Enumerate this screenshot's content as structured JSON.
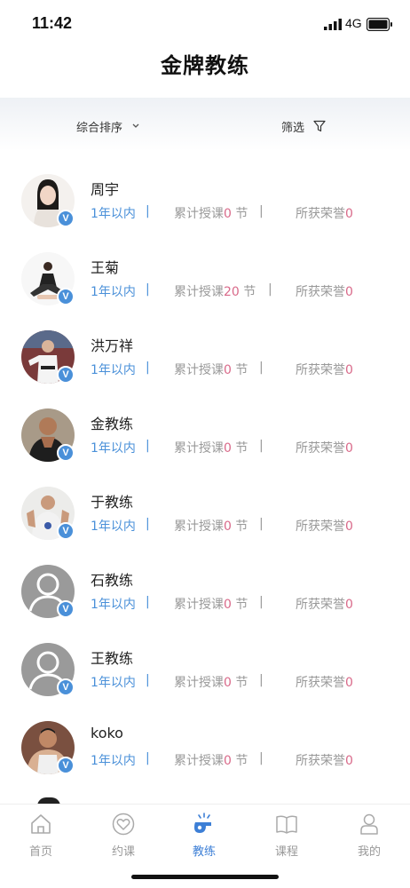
{
  "status_bar": {
    "time": "11:42",
    "network": "4G"
  },
  "header": {
    "title": "金牌教练"
  },
  "filters": {
    "sort_label": "综合排序",
    "filter_label": "筛选"
  },
  "coaches": [
    {
      "name": "周宇",
      "experience": "1年以内",
      "courses_prefix": "累计授课",
      "courses_count": "0",
      "courses_unit": "节",
      "honors_prefix": "所获荣誉",
      "honors_count": "0"
    },
    {
      "name": "王菊",
      "experience": "1年以内",
      "courses_prefix": "累计授课",
      "courses_count": "20",
      "courses_unit": "节",
      "honors_prefix": "所获荣誉",
      "honors_count": "0"
    },
    {
      "name": "洪万祥",
      "experience": "1年以内",
      "courses_prefix": "累计授课",
      "courses_count": "0",
      "courses_unit": "节",
      "honors_prefix": "所获荣誉",
      "honors_count": "0"
    },
    {
      "name": "金教练",
      "experience": "1年以内",
      "courses_prefix": "累计授课",
      "courses_count": "0",
      "courses_unit": "节",
      "honors_prefix": "所获荣誉",
      "honors_count": "0"
    },
    {
      "name": "于教练",
      "experience": "1年以内",
      "courses_prefix": "累计授课",
      "courses_count": "0",
      "courses_unit": "节",
      "honors_prefix": "所获荣誉",
      "honors_count": "0"
    },
    {
      "name": "石教练",
      "experience": "1年以内",
      "courses_prefix": "累计授课",
      "courses_count": "0",
      "courses_unit": "节",
      "honors_prefix": "所获荣誉",
      "honors_count": "0"
    },
    {
      "name": "王教练",
      "experience": "1年以内",
      "courses_prefix": "累计授课",
      "courses_count": "0",
      "courses_unit": "节",
      "honors_prefix": "所获荣誉",
      "honors_count": "0"
    },
    {
      "name": "koko",
      "experience": "1年以内",
      "courses_prefix": "累计授课",
      "courses_count": "0",
      "courses_unit": "节",
      "honors_prefix": "所获荣誉",
      "honors_count": "0"
    }
  ],
  "verified_badge": "V",
  "separator": "|",
  "tabs": [
    {
      "label": "首页",
      "icon": "home-icon"
    },
    {
      "label": "约课",
      "icon": "heart-icon"
    },
    {
      "label": "教练",
      "icon": "whistle-icon"
    },
    {
      "label": "课程",
      "icon": "book-icon"
    },
    {
      "label": "我的",
      "icon": "user-icon"
    }
  ],
  "active_tab": "教练",
  "colors": {
    "accent": "#3d7fd6",
    "experience": "#4a90d9",
    "count": "#d96a8a",
    "muted": "#999999"
  }
}
